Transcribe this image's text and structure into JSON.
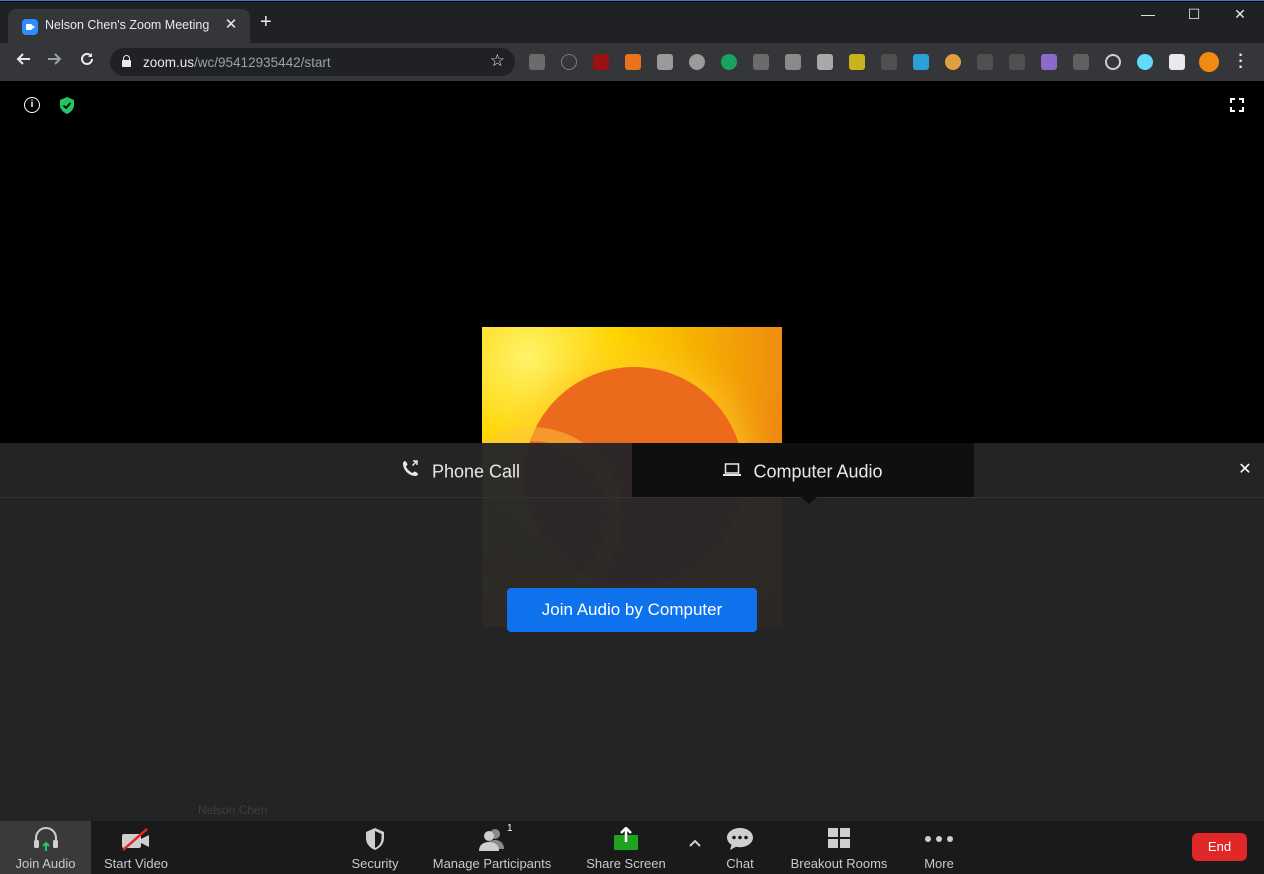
{
  "browser": {
    "tab_title": "Nelson Chen's Zoom Meeting",
    "tab_close": "✕",
    "new_tab": "+",
    "url_host": "zoom.us",
    "url_path": "/wc/95412935442/start",
    "window_controls": {
      "minimize": "—",
      "maximize": "☐",
      "close": "✕"
    }
  },
  "meeting": {
    "participant_name": "Nelson Chen",
    "video_colors": {
      "primary": "#ffd400",
      "secondary": "#ec6a1c"
    }
  },
  "audio_panel": {
    "tabs": [
      {
        "label": "Phone Call",
        "icon": "phone-icon",
        "selected": false
      },
      {
        "label": "Computer Audio",
        "icon": "laptop-icon",
        "selected": true
      }
    ],
    "join_button": "Join Audio by Computer",
    "close": "✕"
  },
  "footer": {
    "join_audio": "Join Audio",
    "start_video": "Start Video",
    "security": "Security",
    "manage_participants": "Manage Participants",
    "participant_count": "1",
    "share_screen": "Share Screen",
    "chat": "Chat",
    "breakout_rooms": "Breakout Rooms",
    "more": "More",
    "end": "End"
  },
  "colors": {
    "accent": "#0e72ed",
    "end": "#e02828",
    "share": "#1ea31e"
  }
}
